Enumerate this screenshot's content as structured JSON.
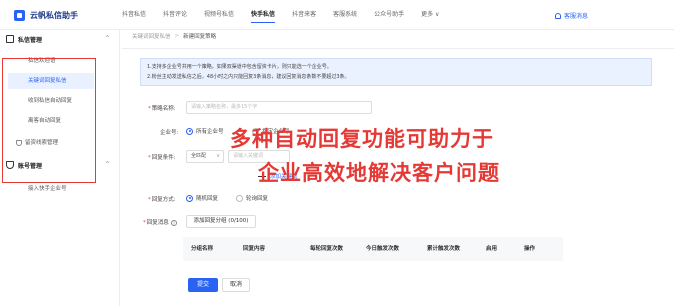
{
  "app": {
    "title": "云帆私信助手"
  },
  "nav": {
    "items": [
      "抖音私信",
      "抖音评论",
      "视频号私信",
      "快手私信",
      "抖音来客",
      "客服系统",
      "公众号助手",
      "更多"
    ],
    "active_index": 3
  },
  "top_right": {
    "message_label": "客服消息"
  },
  "sidebar": {
    "groups": [
      {
        "label": "私信管理",
        "items": [
          "私信欢迎语",
          "关键词回复私信",
          "收到私信自动回复",
          "离客自动回复",
          "留资线索管理"
        ]
      },
      {
        "label": "账号管理",
        "items": [
          "接入快手企业号"
        ]
      }
    ],
    "active_item": "关键词回复私信"
  },
  "breadcrumb": {
    "parent": "关键词回复私信",
    "separator": ">",
    "current": "新建回复策略"
  },
  "notice": {
    "line1": "1.支持多企业号共用一个策略。如果双渠道中包含留资卡片，则只能选一个企业号。",
    "line2": "2.粉丝主动发送私信之后，48小时之内只能回复3条消息，建议回复消息条数不要超过3条。"
  },
  "form": {
    "strategy_name_label": "策略名称:",
    "strategy_name_placeholder": "请输入策略名称，最多15个字",
    "enterprise_label": "企业号:",
    "enterprise_options": [
      "所有企业号",
      "指定企业号"
    ],
    "condition_label": "回复条件:",
    "condition_select": "全匹配",
    "keyword_placeholder": "请输入关键词",
    "add_keyword_label": "添加关键词",
    "reply_mode_label": "回复方式:",
    "reply_mode_options": [
      "随机回复",
      "轮询回复"
    ],
    "reply_msg_label": "回复消息",
    "add_group_label": "添加回复分组 (0/100)"
  },
  "table": {
    "columns": [
      "分组名称",
      "回复内容",
      "每轮回复次数",
      "今日触发次数",
      "累计触发次数",
      "启用",
      "操作"
    ]
  },
  "actions": {
    "submit": "提交",
    "cancel": "取消"
  },
  "overlay": {
    "line1": "多种自动回复功能可助力于",
    "line2": "企业高效地解决客户问题"
  },
  "colors": {
    "accent": "#2a63f4",
    "overlay_red": "#e53935",
    "notice_bg": "#eaf1ff"
  },
  "icons": {
    "logo": "logo-icon",
    "bell": "bell-icon",
    "group_chat": "chat-square-icon",
    "group_account": "shield-icon"
  }
}
